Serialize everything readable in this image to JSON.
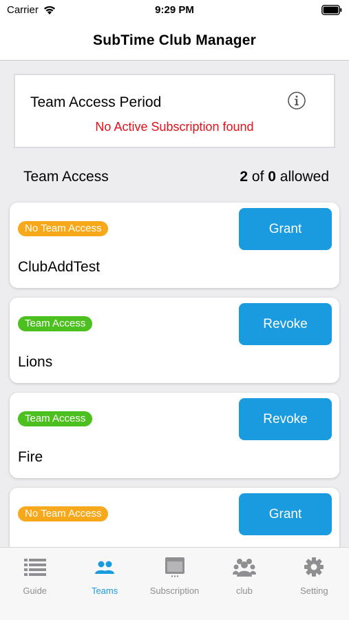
{
  "status": {
    "carrier": "Carrier",
    "time": "9:29 PM"
  },
  "nav": {
    "title": "SubTime Club Manager"
  },
  "period": {
    "title": "Team Access Period",
    "message": "No Active Subscription found"
  },
  "access": {
    "label": "Team Access",
    "used": "2",
    "of": "of",
    "total": "0",
    "suffix": "allowed"
  },
  "teams": [
    {
      "badge": "No Team Access",
      "badge_color": "#f7a81b",
      "name": "ClubAddTest",
      "action": "Grant"
    },
    {
      "badge": "Team Access",
      "badge_color": "#4cc01e",
      "name": "Lions",
      "action": "Revoke"
    },
    {
      "badge": "Team Access",
      "badge_color": "#4cc01e",
      "name": "Fire",
      "action": "Revoke"
    },
    {
      "badge": "No Team Access",
      "badge_color": "#f7a81b",
      "name": "",
      "action": "Grant"
    }
  ],
  "tabs": [
    {
      "label": "Guide",
      "icon": "list-icon"
    },
    {
      "label": "Teams",
      "icon": "people-icon"
    },
    {
      "label": "Subscription",
      "icon": "subscription-icon"
    },
    {
      "label": "club",
      "icon": "group-icon"
    },
    {
      "label": "Setting",
      "icon": "gear-icon"
    }
  ],
  "colors": {
    "accent": "#1a9bdf",
    "error": "#e3121a",
    "inactive_tab": "#8e8e93"
  }
}
